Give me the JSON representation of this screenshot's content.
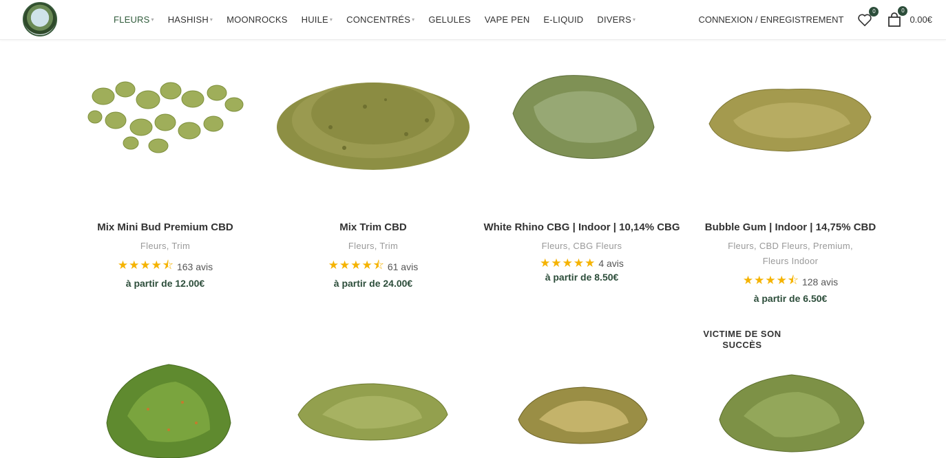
{
  "header": {
    "nav": [
      {
        "label": "FLEURS",
        "dropdown": true,
        "active": true
      },
      {
        "label": "HASHISH",
        "dropdown": true
      },
      {
        "label": "MOONROCKS",
        "dropdown": false
      },
      {
        "label": "HUILE",
        "dropdown": true
      },
      {
        "label": "CONCENTRÉS",
        "dropdown": true
      },
      {
        "label": "GELULES",
        "dropdown": false
      },
      {
        "label": "VAPE PEN",
        "dropdown": false
      },
      {
        "label": "E-LIQUID",
        "dropdown": false
      },
      {
        "label": "DIVERS",
        "dropdown": true
      }
    ],
    "account_label": "CONNEXION / ENREGISTREMENT",
    "wishlist_count": "0",
    "cart_count": "0",
    "cart_total": "0.00€"
  },
  "products": [
    {
      "title": "Mix Mini Bud Premium CBD",
      "categories": "Fleurs, Trim",
      "stars": "★★★★⯪",
      "reviews": "163 avis",
      "price": "à partir de 12.00€"
    },
    {
      "title": "Mix Trim CBD",
      "categories": "Fleurs, Trim",
      "stars": "★★★★⯪",
      "reviews": "61 avis",
      "price": "à partir de 24.00€"
    },
    {
      "title": "White Rhino CBG | Indoor | 10,14% CBG",
      "categories": "Fleurs, CBG Fleurs",
      "stars": "★★★★★",
      "reviews": "4 avis",
      "price": "à partir de 8.50€"
    },
    {
      "title": "Bubble Gum | Indoor | 14,75% CBD",
      "categories": "Fleurs, CBD Fleurs, Premium, Fleurs Indoor",
      "stars": "★★★★⯪",
      "reviews": "128 avis",
      "price": "à partir de 6.50€"
    }
  ],
  "sold_out_tag": "VICTIME DE SON SUCCÈS",
  "colors": {
    "accent": "#2c4d3a",
    "star": "#f5b301"
  }
}
